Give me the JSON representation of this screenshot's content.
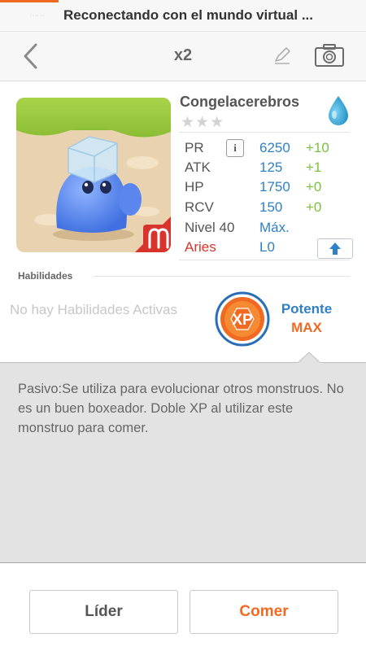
{
  "status_bar": {
    "message": "Reconectando con el mundo virtual ...",
    "progress": 0.16
  },
  "nav": {
    "title": "x2",
    "icons": [
      "chevron-left-icon",
      "pencil-icon",
      "camera-icon"
    ]
  },
  "monster": {
    "name": "Congelacerebros",
    "stars": "★★★",
    "element_icon": "water-drop-icon",
    "zodiac_icon": "aries-icon",
    "stats": [
      {
        "label": "PR",
        "value": "6250",
        "bonus": "+10"
      },
      {
        "label": "ATK",
        "value": "125",
        "bonus": "+1"
      },
      {
        "label": "HP",
        "value": "1750",
        "bonus": "+0"
      },
      {
        "label": "RCV",
        "value": "150",
        "bonus": "+0"
      }
    ],
    "level_label": "Nivel 40",
    "level_value": "Máx.",
    "sign_label": "Aries",
    "sign_value": "L0"
  },
  "abilities": {
    "heading": "Habilidades",
    "none_text": "No hay Habilidades Activas",
    "badge_text": "XP",
    "skill_name": "Potente",
    "skill_level": "MAX"
  },
  "description": "Pasivo:Se utiliza para evolucionar otros monstruos. No es un buen boxeador. Doble XP al utilizar este monstruo para comer.",
  "buttons": {
    "leader": "Líder",
    "eat": "Comer"
  },
  "colors": {
    "accent_orange": "#f26a21",
    "stat_blue": "#2f80c6",
    "bonus_green": "#7bc13f",
    "aries_red": "#d9342b"
  }
}
